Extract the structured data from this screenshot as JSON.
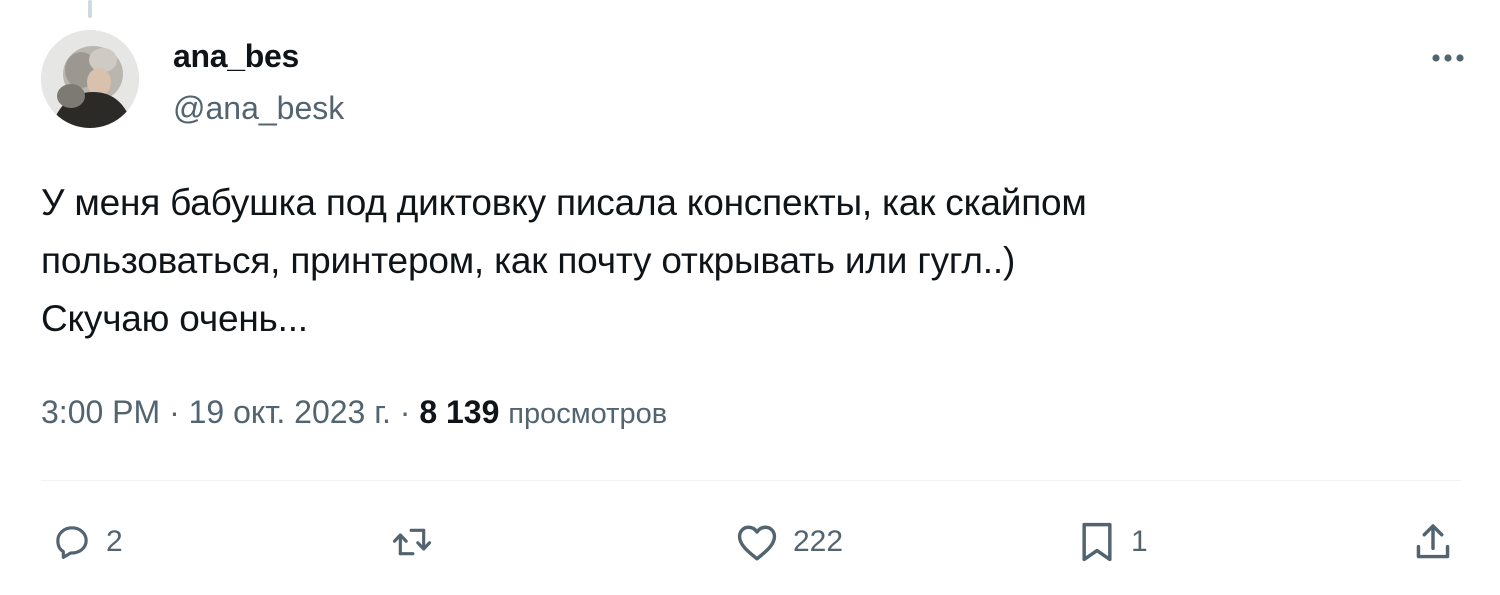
{
  "tweet": {
    "author": {
      "display_name": "ana_bes",
      "handle": "@ana_besk"
    },
    "text_lines": [
      "У меня бабушка под диктовку писала конспекты, как скайпом",
      "пользоваться, принтером, как почту открывать или гугл..)",
      "Скучаю очень..."
    ],
    "meta": {
      "time": "3:00 PM",
      "separator": "·",
      "date": "19 окт. 2023 г.",
      "views_count": "8 139",
      "views_label": "просмотров"
    },
    "actions": {
      "replies": "2",
      "reposts": "",
      "likes": "222",
      "bookmarks": "1"
    },
    "icons": {
      "more": "more-icon",
      "reply": "reply-icon",
      "repost": "repost-icon",
      "like": "heart-icon",
      "bookmark": "bookmark-icon",
      "share": "share-icon"
    }
  }
}
